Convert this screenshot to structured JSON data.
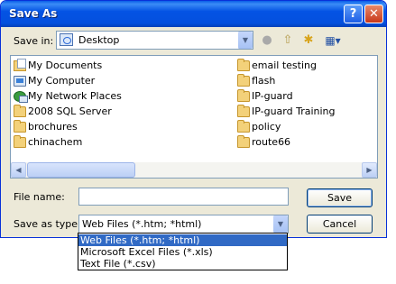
{
  "window": {
    "title": "Save As"
  },
  "title_buttons": {
    "help": "?",
    "close": "✕"
  },
  "lookin": {
    "label": "Save in:",
    "value": "Desktop",
    "arrow": "▼"
  },
  "toolbar": {
    "back": "●",
    "up": "⇧",
    "newfolder": "✱",
    "views": "▦▾"
  },
  "files": {
    "left": [
      {
        "label": "My Documents",
        "icon": "documents-icon"
      },
      {
        "label": "My Computer",
        "icon": "computer-icon"
      },
      {
        "label": "My Network Places",
        "icon": "network-icon"
      },
      {
        "label": "2008 SQL Server",
        "icon": "folder-icon"
      },
      {
        "label": "brochures",
        "icon": "folder-icon"
      },
      {
        "label": "chinachem",
        "icon": "folder-icon"
      }
    ],
    "right": [
      {
        "label": "email testing",
        "icon": "folder-icon"
      },
      {
        "label": "flash",
        "icon": "folder-icon"
      },
      {
        "label": "IP-guard",
        "icon": "folder-icon"
      },
      {
        "label": "IP-guard Training",
        "icon": "folder-icon"
      },
      {
        "label": "policy",
        "icon": "folder-icon"
      },
      {
        "label": "route66",
        "icon": "folder-icon"
      }
    ]
  },
  "scroll": {
    "left": "◀",
    "right": "▶"
  },
  "form": {
    "filename_label": "File name:",
    "filename_value": "",
    "savetype_label": "Save as type:",
    "savetype_value": "Web Files (*.htm; *html)",
    "savetype_arrow": "▼"
  },
  "buttons": {
    "save": "Save",
    "cancel": "Cancel"
  },
  "dropdown": {
    "options": [
      {
        "label": "Web Files (*.htm; *html)",
        "selected": true
      },
      {
        "label": "Microsoft Excel Files (*.xls)",
        "selected": false
      },
      {
        "label": "Text File (*.csv)",
        "selected": false
      }
    ]
  },
  "colors": {
    "titlebar": "#0453e4",
    "selection": "#316ac5",
    "dialog": "#ece9d8"
  }
}
